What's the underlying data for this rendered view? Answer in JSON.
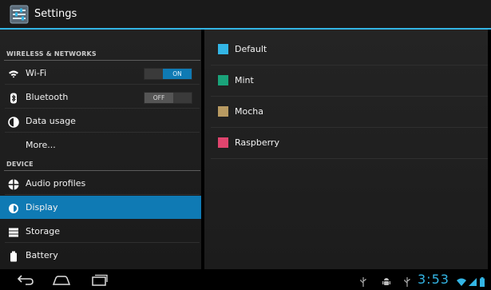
{
  "app": {
    "title": "Settings"
  },
  "sidebar": {
    "sections": [
      {
        "header": "WIRELESS & NETWORKS",
        "items": [
          {
            "label": "Wi-Fi",
            "icon": "wifi-icon",
            "toggle": "ON"
          },
          {
            "label": "Bluetooth",
            "icon": "bluetooth-icon",
            "toggle": "OFF"
          },
          {
            "label": "Data usage",
            "icon": "data-usage-icon"
          },
          {
            "label": "More..."
          }
        ]
      },
      {
        "header": "DEVICE",
        "items": [
          {
            "label": "Audio profiles",
            "icon": "audio-profiles-icon"
          },
          {
            "label": "Display",
            "icon": "display-icon",
            "selected": true
          },
          {
            "label": "Storage",
            "icon": "storage-icon"
          },
          {
            "label": "Battery",
            "icon": "battery-icon"
          }
        ]
      }
    ]
  },
  "themes": [
    {
      "label": "Default",
      "color": "#33b5e5"
    },
    {
      "label": "Mint",
      "color": "#1aa37a"
    },
    {
      "label": "Mocha",
      "color": "#b89a62"
    },
    {
      "label": "Raspberry",
      "color": "#e0456e"
    }
  ],
  "status": {
    "time": "3:53"
  },
  "colors": {
    "accent": "#33b5e5",
    "selected": "#0f7ab4"
  }
}
